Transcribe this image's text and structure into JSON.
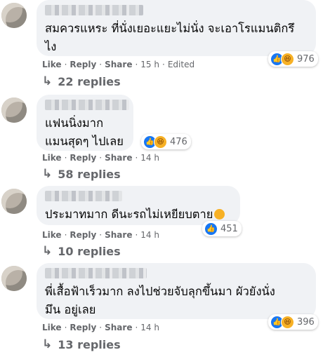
{
  "comments": [
    {
      "text": "สมควรแหระ ที่นั่งเยอะแยะไม่นั่ง จะเอาโรแมนติกรึ\nไง",
      "actions": {
        "like": "Like",
        "reply": "Reply",
        "share": "Share",
        "time": "15 h",
        "edited": "Edited"
      },
      "reactions": {
        "icons": [
          "like-icon",
          "haha-icon"
        ],
        "count": "976"
      },
      "replies": "22 replies"
    },
    {
      "text": "แฟนนิ่งมาก\nแมนสุดๆ ไปเลย",
      "actions": {
        "like": "Like",
        "reply": "Reply",
        "share": "Share",
        "time": "14 h"
      },
      "reactions": {
        "icons": [
          "like-icon",
          "haha-icon"
        ],
        "count": "476"
      },
      "replies": "58 replies"
    },
    {
      "text": "ประมาทมาก ดีนะรถไม่เหยียบตาย",
      "actions": {
        "like": "Like",
        "reply": "Reply",
        "share": "Share",
        "time": "14 h"
      },
      "reactions": {
        "icons": [
          "like-icon"
        ],
        "count": "451"
      },
      "replies": "10 replies"
    },
    {
      "text": "พี่เสื้อฟ้าเร็วมาก ลงไปช่วยจับลุกขึ้นมา ผัวยังนั่ง\nมึน อยู่เลย",
      "actions": {
        "like": "Like",
        "reply": "Reply",
        "share": "Share",
        "time": "14 h"
      },
      "reactions": {
        "icons": [
          "like-icon",
          "haha-icon"
        ],
        "count": "396"
      },
      "replies": "13 replies"
    }
  ],
  "colors": {
    "bubble": "#f0f2f5",
    "like": "#1877f2",
    "haha": "#f7b125",
    "meta": "#65676b"
  }
}
